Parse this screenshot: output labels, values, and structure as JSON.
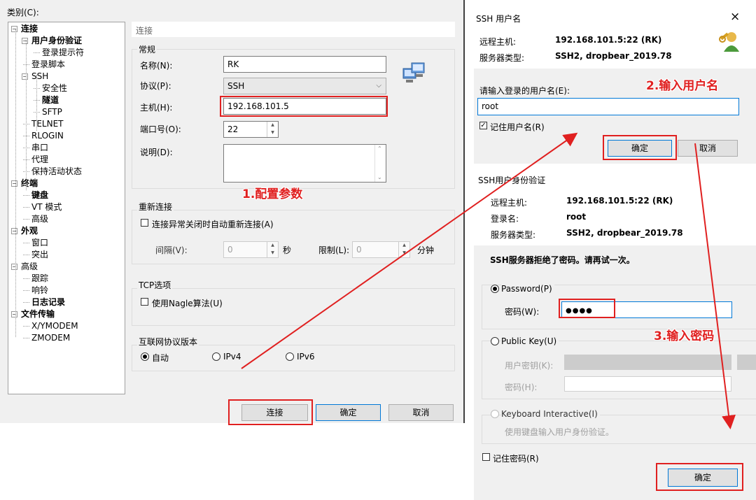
{
  "left": {
    "category_label": "类别(C):",
    "tree": [
      {
        "label": "连接",
        "bold": true,
        "level": 0,
        "toggle": "−"
      },
      {
        "label": "用户身份验证",
        "bold": true,
        "level": 1,
        "toggle": "−"
      },
      {
        "label": "登录提示符",
        "bold": false,
        "level": 2
      },
      {
        "label": "登录脚本",
        "bold": false,
        "level": 1
      },
      {
        "label": "SSH",
        "bold": false,
        "level": 1,
        "toggle": "−"
      },
      {
        "label": "安全性",
        "bold": false,
        "level": 2
      },
      {
        "label": "隧道",
        "bold": true,
        "level": 2
      },
      {
        "label": "SFTP",
        "bold": false,
        "level": 2
      },
      {
        "label": "TELNET",
        "bold": false,
        "level": 1
      },
      {
        "label": "RLOGIN",
        "bold": false,
        "level": 1
      },
      {
        "label": "串口",
        "bold": false,
        "level": 1
      },
      {
        "label": "代理",
        "bold": false,
        "level": 1
      },
      {
        "label": "保持活动状态",
        "bold": false,
        "level": 1
      },
      {
        "label": "终端",
        "bold": true,
        "level": 0,
        "toggle": "−"
      },
      {
        "label": "键盘",
        "bold": true,
        "level": 1
      },
      {
        "label": "VT 模式",
        "bold": false,
        "level": 1
      },
      {
        "label": "高级",
        "bold": false,
        "level": 1
      },
      {
        "label": "外观",
        "bold": true,
        "level": 0,
        "toggle": "−"
      },
      {
        "label": "窗口",
        "bold": false,
        "level": 1
      },
      {
        "label": "突出",
        "bold": false,
        "level": 1
      },
      {
        "label": "高级",
        "bold": false,
        "level": 0,
        "toggle": "−"
      },
      {
        "label": "跟踪",
        "bold": false,
        "level": 1
      },
      {
        "label": "响铃",
        "bold": false,
        "level": 1
      },
      {
        "label": "日志记录",
        "bold": true,
        "level": 1
      },
      {
        "label": "文件传输",
        "bold": true,
        "level": 0,
        "toggle": "−"
      },
      {
        "label": "X/YMODEM",
        "bold": false,
        "level": 1
      },
      {
        "label": "ZMODEM",
        "bold": false,
        "level": 1
      }
    ],
    "section_title": "连接",
    "general_title": "常规",
    "name_label": "名称(N):",
    "name_value": "RK",
    "protocol_label": "协议(P):",
    "protocol_value": "SSH",
    "host_label": "主机(H):",
    "host_value": "192.168.101.5",
    "port_label": "端口号(O):",
    "port_value": "22",
    "desc_label": "说明(D):",
    "reconnect_title": "重新连接",
    "reconnect_check": "连接异常关闭时自动重新连接(A)",
    "interval_label": "间隔(V):",
    "interval_value": "0",
    "interval_unit": "秒",
    "limit_label": "限制(L):",
    "limit_value": "0",
    "limit_unit": "分钟",
    "tcp_title": "TCP选项",
    "nagle_check": "使用Nagle算法(U)",
    "ipver_title": "互联网协议版本",
    "ip_auto": "自动",
    "ip_v4": "IPv4",
    "ip_v6": "IPv6",
    "btn_connect": "连接",
    "btn_ok": "确定",
    "btn_cancel": "取消"
  },
  "annotations": {
    "step1": "1.配置参数",
    "step2": "2.输入用户名",
    "step3": "3.输入密码"
  },
  "ssh_user": {
    "title": "SSH 用户名",
    "close": "×",
    "remote_host_label": "远程主机:",
    "remote_host_value": "192.168.101.5:22 (RK)",
    "server_type_label": "服务器类型:",
    "server_type_value": "SSH2, dropbear_2019.78",
    "prompt": "请输入登录的用户名(E):",
    "username_value": "root",
    "remember_label": "记住用户名(R)",
    "ok": "确定",
    "cancel": "取消"
  },
  "ssh_auth": {
    "title": "SSH用户身份验证",
    "remote_host_label": "远程主机:",
    "remote_host_value": "192.168.101.5:22 (RK)",
    "login_label": "登录名:",
    "login_value": "root",
    "server_type_label": "服务器类型:",
    "server_type_value": "SSH2, dropbear_2019.78",
    "rejected_msg": "SSH服务器拒绝了密码。请再试一次。",
    "password_radio": "Password(P)",
    "password_label": "密码(W):",
    "password_value": "●●●●",
    "pubkey_radio": "Public Key(U)",
    "user_key_label": "用户密钥(K):",
    "passphrase_label": "密码(H):",
    "kbd_radio": "Keyboard Interactive(I)",
    "kbd_hint": "使用键盘输入用户身份验证。",
    "remember_pw": "记住密码(R)",
    "ok": "确定"
  }
}
